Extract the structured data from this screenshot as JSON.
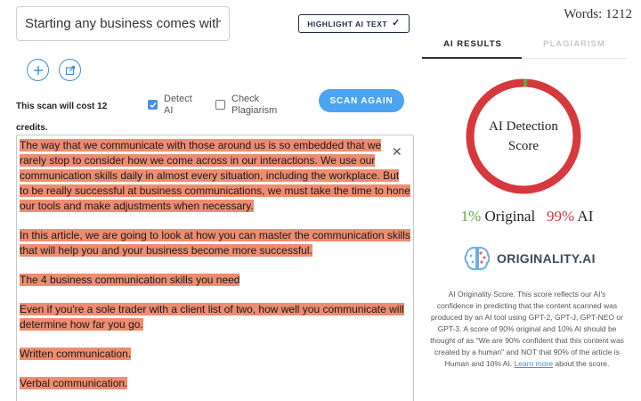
{
  "title_input": {
    "value": "Starting any business comes with"
  },
  "toolbar": {
    "highlight_label": "HIGHLIGHT AI TEXT",
    "highlight_icon": "check-icon"
  },
  "actions": {
    "add_icon": "plus-icon",
    "share_icon": "share-icon"
  },
  "scan": {
    "cost_text": "This scan will cost 12 credits.",
    "detect_ai_label": "Detect AI",
    "detect_ai_checked": true,
    "check_plagiarism_label": "Check Plagiarism",
    "check_plagiarism_checked": false,
    "scan_again_label": "SCAN AGAIN"
  },
  "editor": {
    "paragraphs": [
      "The way that we communicate with those around us is so embedded that we rarely stop to consider how we come across in our interactions. We use our communication skills daily in almost every situation, including the workplace. But to be really successful at business communications, we must take the time to hone our tools and make adjustments when necessary.",
      "In this article, we are going to look at how you can master the communication skills that will help you and your business become more successful.",
      "The 4 business communication skills you need",
      "Even if you're a sole trader with a client list of two, how well you communicate will determine how far you go.",
      "Written communication.",
      "Verbal communication."
    ],
    "highlight_color": "#ee8c70",
    "close_icon": "close-icon"
  },
  "stats": {
    "words_label": "Words: 1212"
  },
  "tabs": {
    "ai_results": "AI RESULTS",
    "plagiarism": "PLAGIARISM"
  },
  "score": {
    "label_line1": "AI Detection",
    "label_line2": "Score",
    "original_percent": "1%",
    "original_label": "Original",
    "ai_percent": "99%",
    "ai_label": "AI",
    "ai_fraction": 0.99,
    "ring_ai_color": "#d6383d",
    "ring_original_color": "#58a83a"
  },
  "brand": {
    "logo_text": "ORIGINALITY.AI",
    "logo_icon": "brain-icon"
  },
  "description": {
    "text": "AI Originality Score. This score reflects our AI's confidence in predicting that the content scanned was produced by an AI tool using GPT-2, GPT-J, GPT-NEO or GPT-3. A score of 90% original and 10% AI should be thought of as \"We are 90% confident that this content was created by a human\" and NOT that 90% of the article is Human and 10% AI.",
    "link_text": "Learn more",
    "suffix": "about the score."
  }
}
